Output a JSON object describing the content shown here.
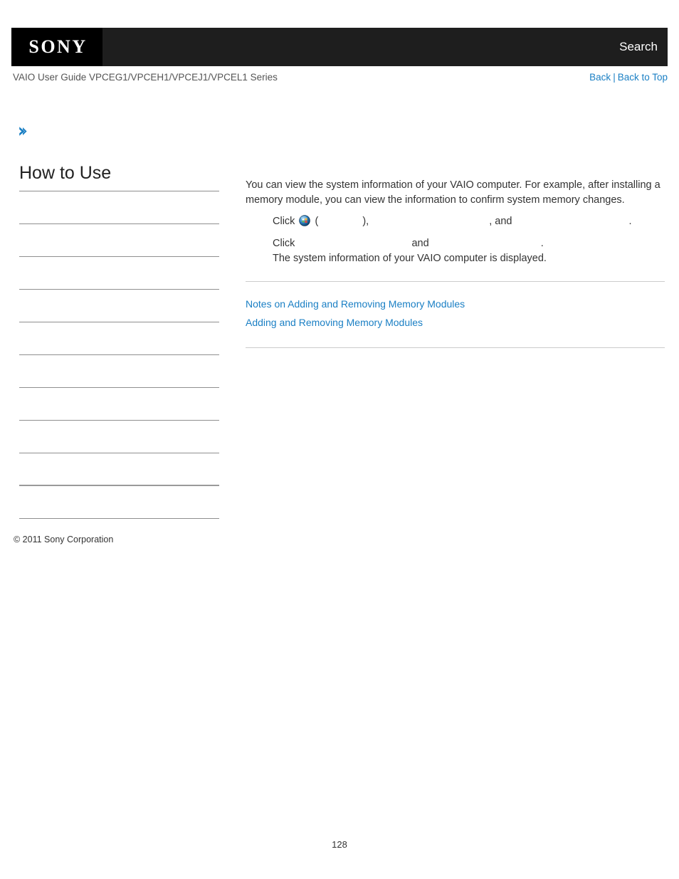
{
  "header": {
    "logo_text": "SONY",
    "search_label": "Search"
  },
  "sub_header": {
    "guide_title": "VAIO User Guide VPCEG1/VPCEH1/VPCEJ1/VPCEL1 Series",
    "back_label": "Back",
    "separator": "|",
    "back_to_top_label": "Back to Top"
  },
  "breadcrumb": {
    "chevron_icon": "chevron-right-icon",
    "label": ""
  },
  "sidebar": {
    "title": "How to Use",
    "items": [
      {
        "label": ""
      },
      {
        "label": ""
      },
      {
        "label": ""
      },
      {
        "label": ""
      },
      {
        "label": ""
      },
      {
        "label": ""
      },
      {
        "label": ""
      },
      {
        "label": ""
      },
      {
        "label": ""
      },
      {
        "label": ""
      }
    ]
  },
  "main": {
    "intro": "You can view the system information of your VAIO computer. For example, after installing a memory module, you can view the information to confirm system memory changes.",
    "steps": [
      {
        "prefix": "Click ",
        "icon": "windows-start-orb-icon",
        "after_icon": " (",
        "blank1": "",
        "mid1": "), ",
        "blank2": "",
        "mid2": ", and ",
        "blank3": "",
        "suffix": "."
      },
      {
        "prefix": "Click ",
        "blank1": "",
        "mid1": " and ",
        "blank2": "",
        "suffix": ".",
        "second_line": "The system information of your VAIO computer is displayed."
      }
    ],
    "related_links": [
      {
        "label": "Notes on Adding and Removing Memory Modules"
      },
      {
        "label": "Adding and Removing Memory Modules"
      }
    ]
  },
  "footer": {
    "copyright": "© 2011 Sony Corporation",
    "page_number": "128"
  },
  "colors": {
    "link": "#1a7fc4",
    "header_bg": "#1e1e1e",
    "logo_bg": "#000000",
    "rule": "#8f8f8f",
    "content_rule": "#cccccc"
  }
}
